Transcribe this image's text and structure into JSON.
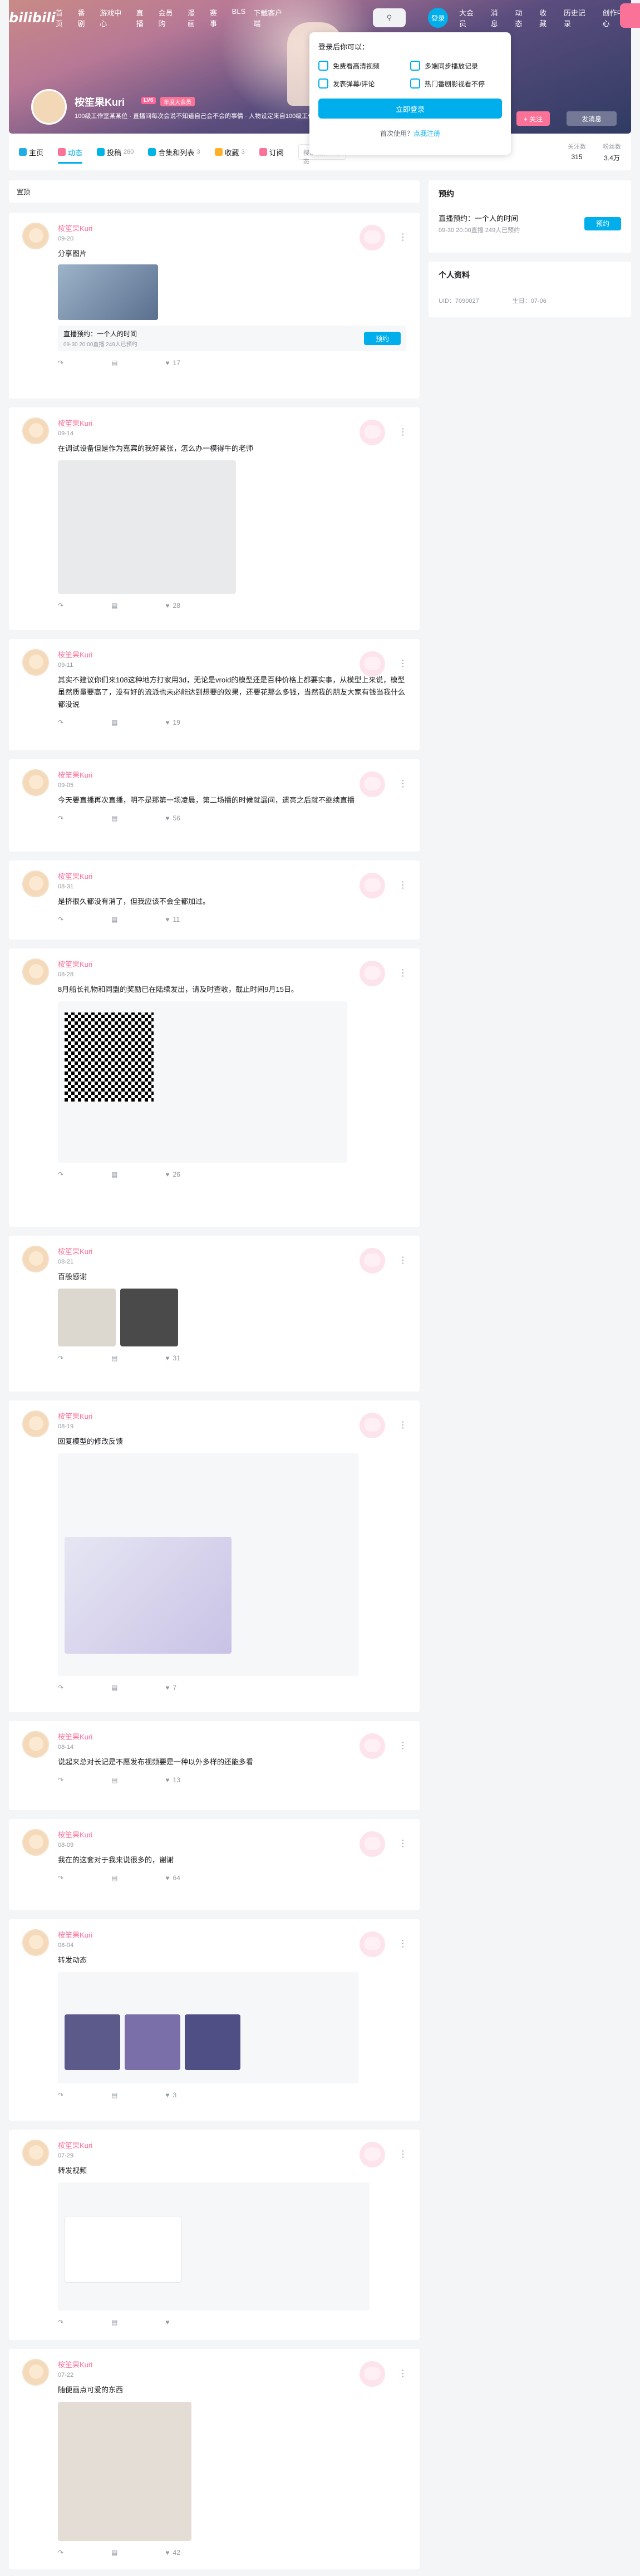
{
  "topbar": {
    "logo": "bilibili",
    "nav_left": [
      "首页",
      "番剧",
      "游戏中心",
      "直播",
      "会员购",
      "漫画",
      "赛事",
      "BLS"
    ],
    "download": "下载客户端",
    "nav_right": [
      "大会员",
      "消息",
      "动态",
      "收藏",
      "历史记录",
      "创作中心"
    ],
    "login": "登录"
  },
  "login_popup": {
    "title": "登录后你可以：",
    "benefits": [
      "免费看高清视频",
      "多端同步播放记录",
      "发表弹幕/评论",
      "热门番剧影视看不停"
    ],
    "login_button": "立即登录",
    "register_prefix": "首次使用？",
    "register_link": "点我注册"
  },
  "profile": {
    "name": "桉笙果Kuri",
    "level": "LV6",
    "vip": "年度大会员",
    "sign": "100级工作室某某位 · 直播间每次会说不知道自己会不会的事情 · 人物设定来自100级工作室",
    "follow": "+ 关注",
    "message": "发消息"
  },
  "tabs": [
    {
      "label": "主页",
      "count": ""
    },
    {
      "label": "动态",
      "count": ""
    },
    {
      "label": "投稿",
      "count": "280"
    },
    {
      "label": "合集和列表",
      "count": "3"
    },
    {
      "label": "收藏",
      "count": "3"
    },
    {
      "label": "订阅",
      "count": ""
    }
  ],
  "tab_search": "搜索视频、动态",
  "stats": [
    {
      "label": "关注数",
      "value": "315"
    },
    {
      "label": "粉丝数",
      "value": "3.4万"
    }
  ],
  "section_title": "置顶",
  "sidebar": {
    "reserve_title": "预约",
    "live_title": "直播预约：一个人的时间",
    "live_sub": "09-30 20:00直播 249人已预约",
    "reserve_button": "预约",
    "info_title": "个人资料",
    "uid": "UID：7090027",
    "birthday": "生日：07-06"
  },
  "posts": [
    {
      "author": "桉笙果Kuri",
      "time": "09-20",
      "text": "分享图片",
      "likes": "17",
      "comments": "",
      "shares": "",
      "extra": "live"
    },
    {
      "author": "桉笙果Kuri",
      "time": "09-14",
      "text": "在调试设备但是作为嘉宾的我好紧张，怎么办一模得牛的老师",
      "likes": "28",
      "comments": "",
      "shares": "",
      "extra": "image"
    },
    {
      "author": "桉笙果Kuri",
      "time": "09-11",
      "text": "其实不建议你们来108这种地方打家用3d，无论是vroid的模型还是百种价格上都要实事，从模型上来说，模型虽然质量要高了，没有好的流派也未必能达到想要的效果，还要花那么多钱，当然我的朋友大家有钱当我什么都没说",
      "likes": "19",
      "comments": "",
      "shares": "",
      "extra": ""
    },
    {
      "author": "桉笙果Kuri",
      "time": "09-05",
      "text": "今天要直播再次直播，明不是那第一场凌晨，第二场播的时候就漏间，遗亮之后就不继续直播",
      "likes": "56",
      "comments": "",
      "shares": "",
      "extra": ""
    },
    {
      "author": "桉笙果Kuri",
      "time": "08-31",
      "text": "是挤很久都没有消了，但我应该不会全都加过。",
      "likes": "11",
      "comments": "",
      "shares": "",
      "extra": ""
    },
    {
      "author": "桉笙果Kuri",
      "time": "08-28",
      "text": "8月船长礼物和同盟的奖励已在陆续发出，请及时查收，截止时间9月15日。",
      "likes": "26",
      "comments": "",
      "shares": "",
      "extra": "qr"
    },
    {
      "author": "桉笙果Kuri",
      "time": "08-21",
      "text": "百般感谢",
      "likes": "31",
      "comments": "",
      "shares": "",
      "extra": "photos"
    },
    {
      "author": "桉笙果Kuri",
      "time": "08-19",
      "text": "回复模型的修改反馈",
      "likes": "7",
      "comments": "",
      "shares": "",
      "extra": "repost"
    },
    {
      "author": "桉笙果Kuri",
      "time": "08-14",
      "text": "说起来总对长记是不愿发布视频要是一种以外多样的还能多看",
      "likes": "13",
      "comments": "",
      "shares": "",
      "extra": ""
    },
    {
      "author": "桉笙果Kuri",
      "time": "08-09",
      "text": "我在的这套对于我来说很多的，谢谢",
      "likes": "64",
      "comments": "",
      "shares": "",
      "extra": ""
    },
    {
      "author": "桉笙果Kuri",
      "time": "08-04",
      "text": "转发动态",
      "likes": "3",
      "comments": "",
      "shares": "",
      "extra": "gallery"
    },
    {
      "author": "桉笙果Kuri",
      "time": "07-29",
      "text": "转发视频",
      "likes": "",
      "comments": "",
      "shares": "",
      "extra": "video"
    },
    {
      "author": "桉笙果Kuri",
      "time": "07-22",
      "text": "随便画点可爱的东西",
      "likes": "42",
      "comments": "",
      "shares": "",
      "extra": "sketch"
    }
  ]
}
